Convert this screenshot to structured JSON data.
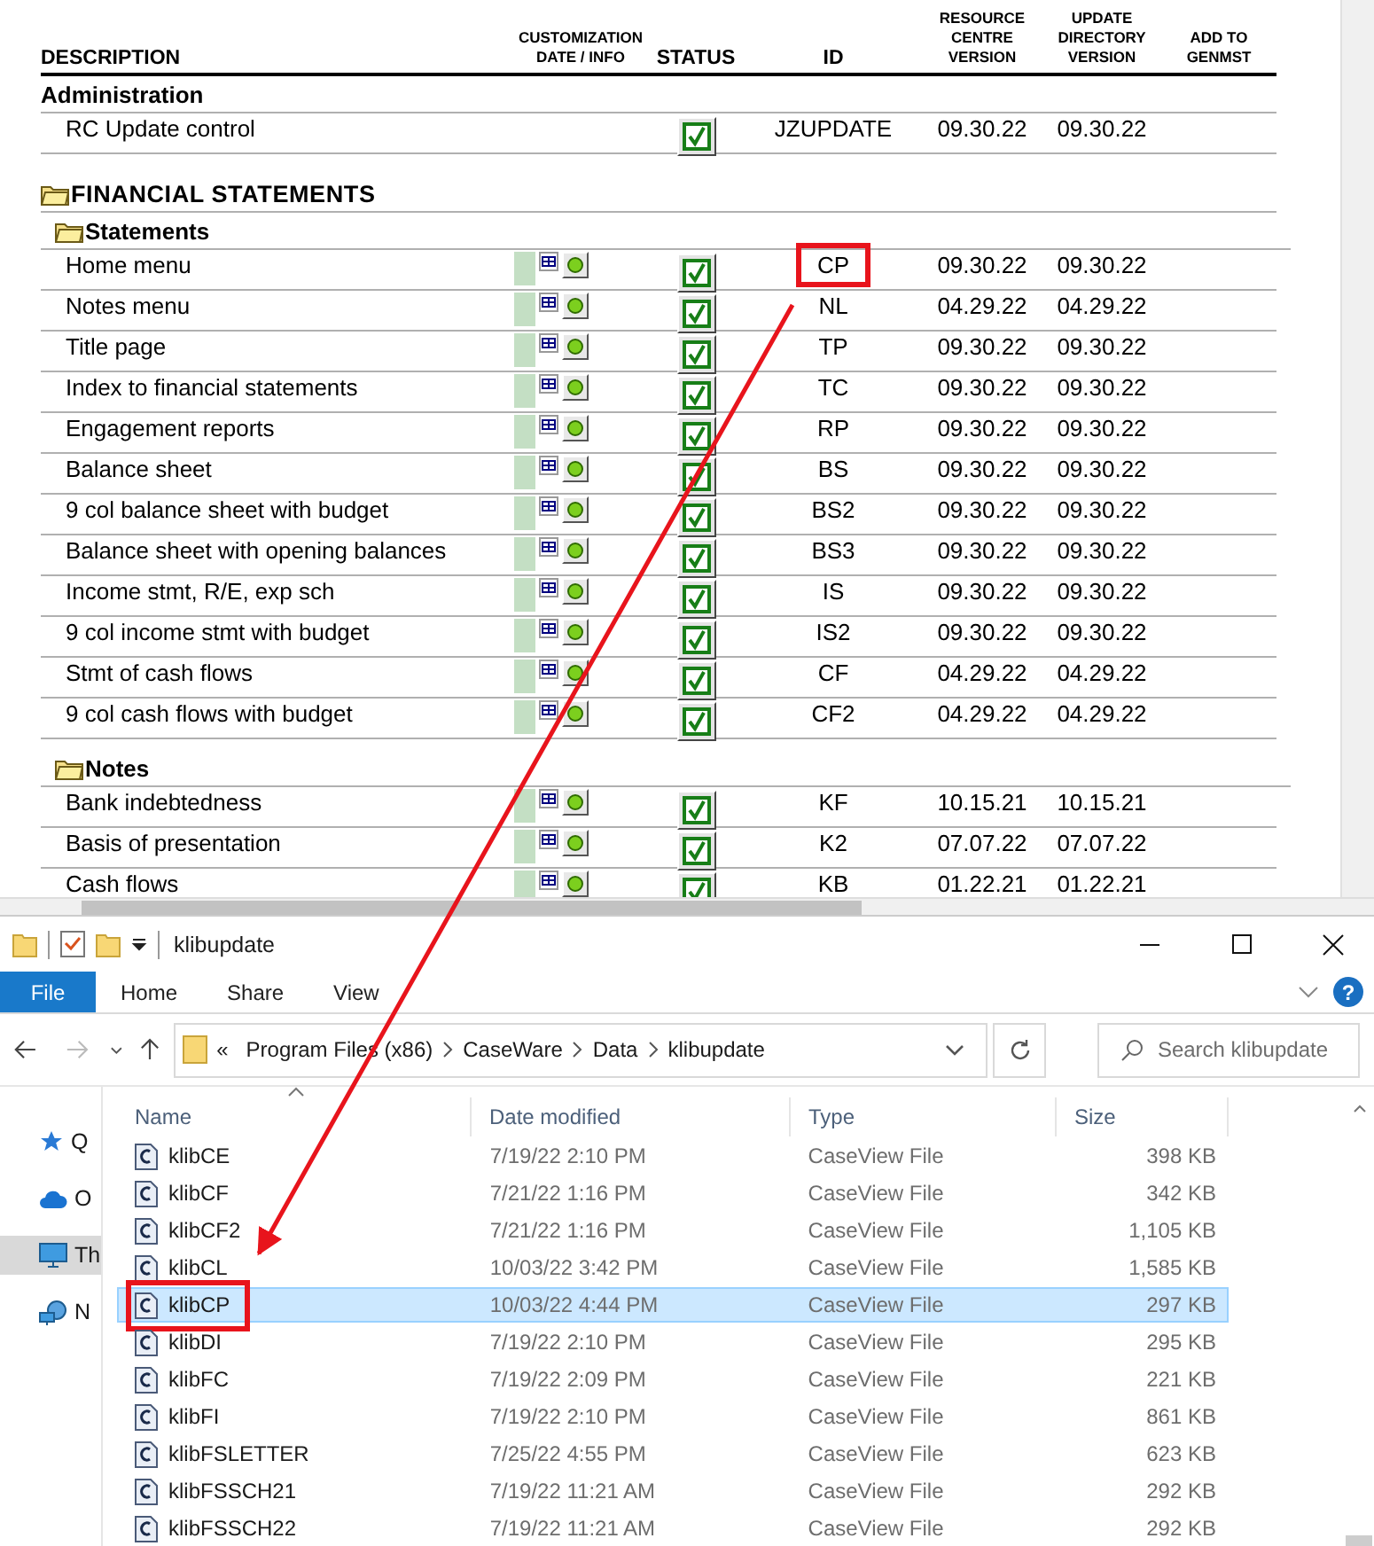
{
  "document": {
    "columns": [
      {
        "label": "DESCRIPTION",
        "kind": "main"
      },
      {
        "label": "CUSTOMIZATION DATE / INFO",
        "kind": "small"
      },
      {
        "label": "STATUS",
        "kind": "main"
      },
      {
        "label": "ID",
        "kind": "main"
      },
      {
        "label": "RESOURCE CENTRE VERSION",
        "kind": "small"
      },
      {
        "label": "UPDATE DIRECTORY VERSION",
        "kind": "small"
      },
      {
        "label": "ADD TO GENMST",
        "kind": "small"
      }
    ],
    "groups": [
      {
        "title": "Administration",
        "kind": "plain",
        "rows": [
          {
            "description": "RC Update control",
            "customization": false,
            "checked": true,
            "id": "JZUPDATE",
            "rc_version": "09.30.22",
            "update_version": "09.30.22",
            "highlighted": false
          }
        ]
      },
      {
        "title": "FINANCIAL STATEMENTS",
        "kind": "folder",
        "children": [
          {
            "title": "Statements",
            "kind": "folder",
            "rows": [
              {
                "description": "Home menu",
                "customization": true,
                "checked": true,
                "id": "CP",
                "rc_version": "09.30.22",
                "update_version": "09.30.22",
                "highlighted": true
              },
              {
                "description": "Notes menu",
                "customization": true,
                "checked": true,
                "id": "NL",
                "rc_version": "04.29.22",
                "update_version": "04.29.22",
                "highlighted": false
              },
              {
                "description": "Title page",
                "customization": true,
                "checked": true,
                "id": "TP",
                "rc_version": "09.30.22",
                "update_version": "09.30.22",
                "highlighted": false
              },
              {
                "description": "Index to financial statements",
                "customization": true,
                "checked": true,
                "id": "TC",
                "rc_version": "09.30.22",
                "update_version": "09.30.22",
                "highlighted": false
              },
              {
                "description": "Engagement reports",
                "customization": true,
                "checked": true,
                "id": "RP",
                "rc_version": "09.30.22",
                "update_version": "09.30.22",
                "highlighted": false
              },
              {
                "description": "Balance sheet",
                "customization": true,
                "checked": true,
                "id": "BS",
                "rc_version": "09.30.22",
                "update_version": "09.30.22",
                "highlighted": false
              },
              {
                "description": "9 col balance sheet with budget",
                "customization": true,
                "checked": true,
                "id": "BS2",
                "rc_version": "09.30.22",
                "update_version": "09.30.22",
                "highlighted": false
              },
              {
                "description": "Balance sheet with opening balances",
                "customization": true,
                "checked": true,
                "id": "BS3",
                "rc_version": "09.30.22",
                "update_version": "09.30.22",
                "highlighted": false
              },
              {
                "description": "Income stmt, R/E, exp sch",
                "customization": true,
                "checked": true,
                "id": "IS",
                "rc_version": "09.30.22",
                "update_version": "09.30.22",
                "highlighted": false
              },
              {
                "description": "9 col income stmt with budget",
                "customization": true,
                "checked": true,
                "id": "IS2",
                "rc_version": "09.30.22",
                "update_version": "09.30.22",
                "highlighted": false
              },
              {
                "description": "Stmt of cash flows",
                "customization": true,
                "checked": true,
                "id": "CF",
                "rc_version": "04.29.22",
                "update_version": "04.29.22",
                "highlighted": false
              },
              {
                "description": "9 col cash flows with budget",
                "customization": true,
                "checked": true,
                "id": "CF2",
                "rc_version": "04.29.22",
                "update_version": "04.29.22",
                "highlighted": false
              }
            ]
          },
          {
            "title": "Notes",
            "kind": "folder",
            "rows": [
              {
                "description": "Bank indebtedness",
                "customization": true,
                "checked": true,
                "id": "KF",
                "rc_version": "10.15.21",
                "update_version": "10.15.21",
                "highlighted": false
              },
              {
                "description": "Basis of presentation",
                "customization": true,
                "checked": true,
                "id": "K2",
                "rc_version": "07.07.22",
                "update_version": "07.07.22",
                "highlighted": false
              },
              {
                "description": "Cash flows",
                "customization": true,
                "checked": true,
                "id": "KB",
                "rc_version": "01.22.21",
                "update_version": "01.22.21",
                "highlighted": false
              }
            ]
          }
        ]
      }
    ]
  },
  "explorer": {
    "window": {
      "title": "klibupdate"
    },
    "ribbon_tabs": [
      {
        "label": "File",
        "selected": true
      },
      {
        "label": "Home",
        "selected": false
      },
      {
        "label": "Share",
        "selected": false
      },
      {
        "label": "View",
        "selected": false
      }
    ],
    "help": "?",
    "address": {
      "overflow": "«",
      "crumbs": [
        "Program Files (x86)",
        "CaseWare",
        "Data",
        "klibupdate"
      ]
    },
    "search": {
      "placeholder": "Search klibupdate"
    },
    "nav_items": [
      {
        "label": "Q",
        "kind": "star",
        "selected": false
      },
      {
        "label": "O",
        "kind": "cloud",
        "selected": false
      },
      {
        "label": "Th",
        "kind": "pc",
        "selected": true
      },
      {
        "label": "N",
        "kind": "network",
        "selected": false
      }
    ],
    "columns": [
      "Name",
      "Date modified",
      "Type",
      "Size"
    ],
    "files": [
      {
        "name": "klibCE",
        "date": "7/19/22 2:10 PM",
        "type": "CaseView File",
        "size": "398 KB",
        "selected": false,
        "highlighted": false
      },
      {
        "name": "klibCF",
        "date": "7/21/22 1:16 PM",
        "type": "CaseView File",
        "size": "342 KB",
        "selected": false,
        "highlighted": false
      },
      {
        "name": "klibCF2",
        "date": "7/21/22 1:16 PM",
        "type": "CaseView File",
        "size": "1,105 KB",
        "selected": false,
        "highlighted": false
      },
      {
        "name": "klibCL",
        "date": "10/03/22 3:42 PM",
        "type": "CaseView File",
        "size": "1,585 KB",
        "selected": false,
        "highlighted": false
      },
      {
        "name": "klibCP",
        "date": "10/03/22 4:44 PM",
        "type": "CaseView File",
        "size": "297 KB",
        "selected": true,
        "highlighted": true
      },
      {
        "name": "klibDI",
        "date": "7/19/22 2:10 PM",
        "type": "CaseView File",
        "size": "295 KB",
        "selected": false,
        "highlighted": false
      },
      {
        "name": "klibFC",
        "date": "7/19/22 2:09 PM",
        "type": "CaseView File",
        "size": "221 KB",
        "selected": false,
        "highlighted": false
      },
      {
        "name": "klibFI",
        "date": "7/19/22 2:10 PM",
        "type": "CaseView File",
        "size": "861 KB",
        "selected": false,
        "highlighted": false
      },
      {
        "name": "klibFSLETTER",
        "date": "7/25/22 4:55 PM",
        "type": "CaseView File",
        "size": "623 KB",
        "selected": false,
        "highlighted": false
      },
      {
        "name": "klibFSSCH21",
        "date": "7/19/22 11:21 AM",
        "type": "CaseView File",
        "size": "292 KB",
        "selected": false,
        "highlighted": false
      },
      {
        "name": "klibFSSCH22",
        "date": "7/19/22 11:21 AM",
        "type": "CaseView File",
        "size": "292 KB",
        "selected": false,
        "highlighted": false
      }
    ]
  }
}
